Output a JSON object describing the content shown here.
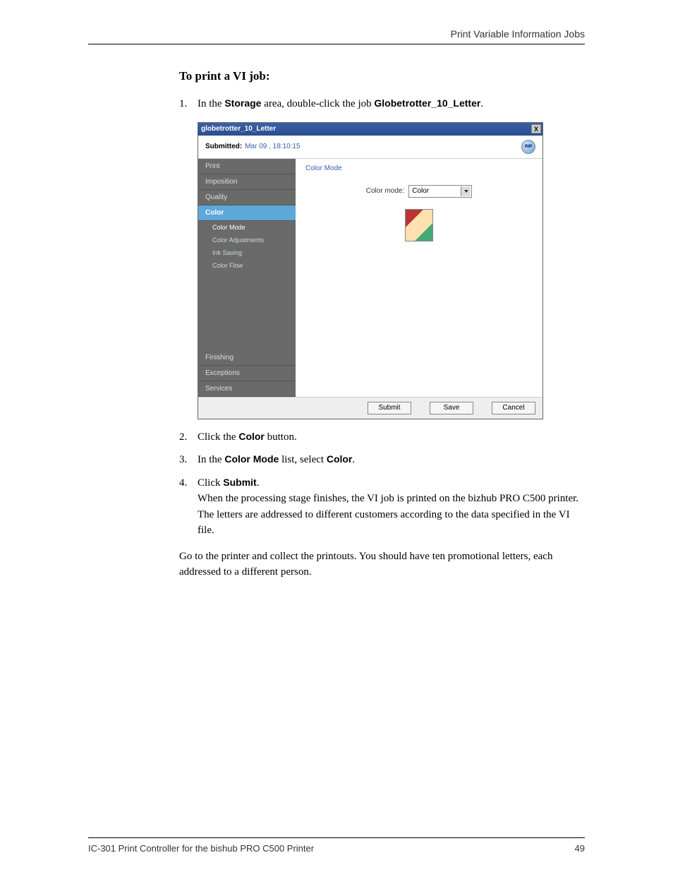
{
  "header": {
    "right": "Print Variable Information Jobs"
  },
  "section_title": "To print a VI job:",
  "steps": {
    "s1": {
      "num": "1.",
      "pre": "In the ",
      "b1": "Storage",
      "mid": " area, double-click the job ",
      "b2": "Globetrotter_10_Letter",
      "post": "."
    },
    "s2": {
      "num": "2.",
      "pre": "Click the ",
      "b1": "Color",
      "post": " button."
    },
    "s3": {
      "num": "3.",
      "pre": "In the ",
      "b1": "Color Mode",
      "mid": " list, select ",
      "b2": "Color",
      "post": "."
    },
    "s4": {
      "num": "4.",
      "pre": "Click ",
      "b1": "Submit",
      "post": ".",
      "body": "When the processing stage finishes, the VI job is printed on the bizhub PRO C500 printer. The letters are addressed to different customers according to the data specified in the VI file."
    }
  },
  "closing": "Go to the printer and collect the printouts. You should have ten promotional letters, each addressed to a different person.",
  "dialog": {
    "title": "globetrotter_10_Letter",
    "close": "X",
    "submitted_label": "Submitted:",
    "submitted_date": "Mar 09 , 18:10:15",
    "rip": "RIP",
    "nav": {
      "print": "Print",
      "imposition": "Imposition",
      "quality": "Quality",
      "color": "Color",
      "color_mode": "Color Mode",
      "color_adjustments": "Color Adjustments",
      "ink_saving": "Ink Saving",
      "color_flow": "Color Flow",
      "finishing": "Finishing",
      "exceptions": "Exceptions",
      "services": "Services"
    },
    "pane": {
      "title": "Color Mode",
      "field_label": "Color mode:",
      "field_value": "Color"
    },
    "buttons": {
      "submit": "Submit",
      "save": "Save",
      "cancel": "Cancel"
    }
  },
  "footer": {
    "left": "IC-301 Print Controller for the bishub PRO C500 Printer",
    "right": "49"
  }
}
